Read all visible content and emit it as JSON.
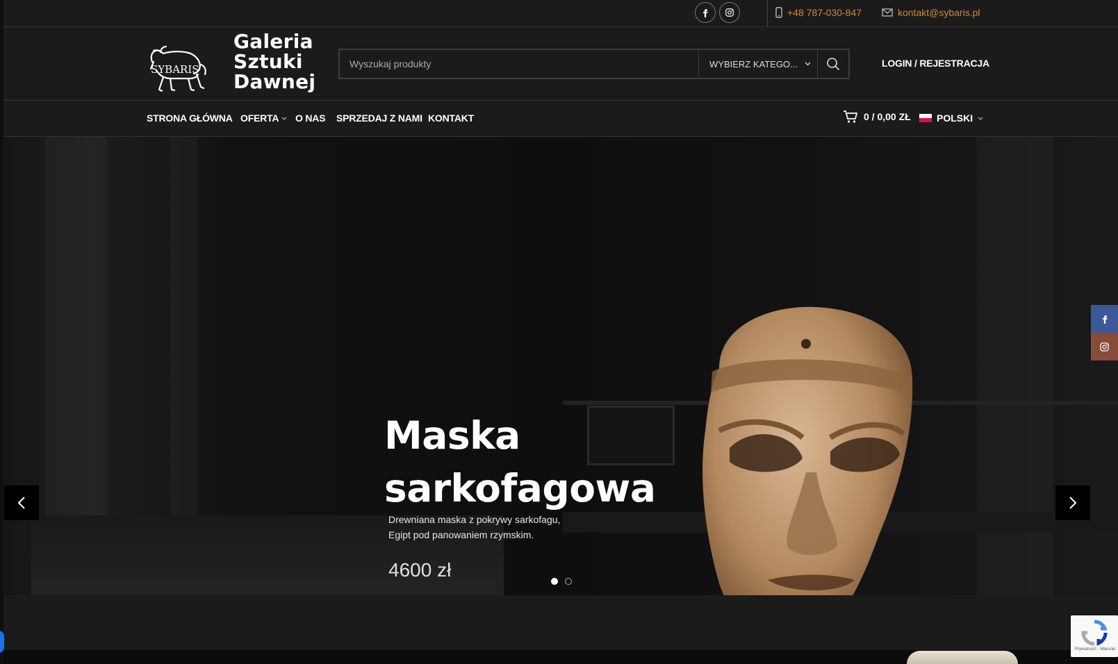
{
  "topbar": {
    "phone": "+48 787-030-847",
    "email": "kontakt@sybaris.pl",
    "social": [
      "facebook-icon",
      "instagram-icon"
    ]
  },
  "header": {
    "logo_text": "SYBARIS",
    "brand_line1": "Galeria",
    "brand_line2": "Sztuki",
    "brand_line3": "Dawnej",
    "search_placeholder": "Wyszukaj produkty",
    "category_label": "WYBIERZ KATEGO...",
    "login_label": "LOGIN / REJESTRACJA"
  },
  "nav": {
    "items": [
      "STRONA GŁÓWNA",
      "OFERTA",
      "O NAS",
      "SPRZEDAJ Z NAMI",
      "KONTAKT"
    ],
    "cart_label": "0 / 0,00 ZŁ",
    "language": "POLSKI"
  },
  "hero": {
    "title_line1": "Maska",
    "title_line2": "sarkofagowa",
    "desc_line1": "Drewniana maska z pokrywy sarkofagu,",
    "desc_line2": "Egipt pod panowaniem rzymskim.",
    "price": "4600 zł",
    "slide_count": 2,
    "active_slide": 1
  },
  "recaptcha": {
    "privacy_text": "Prywatność - Warunki"
  },
  "colors": {
    "accent": "#d08a2a",
    "background": "#1b1b1b",
    "facebook": "#3b5998",
    "instagram": "#8a4a3a"
  }
}
